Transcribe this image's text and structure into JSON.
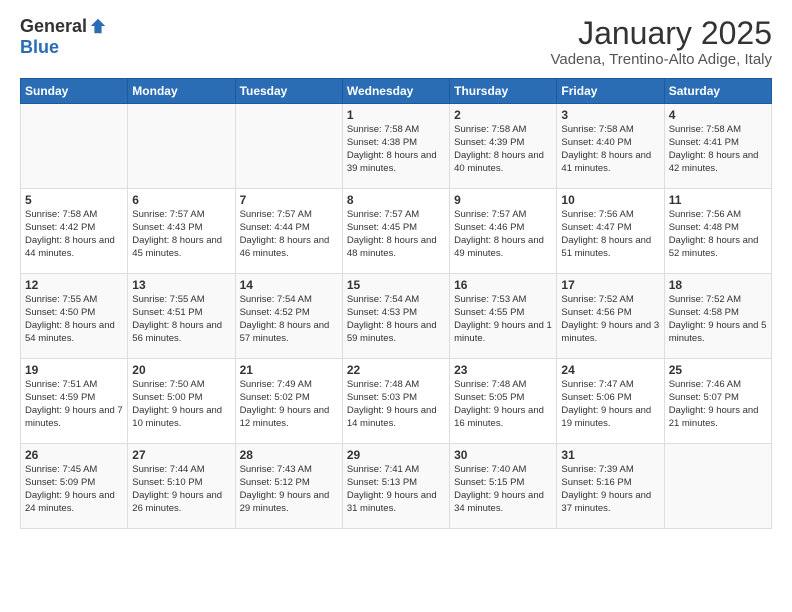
{
  "logo": {
    "general": "General",
    "blue": "Blue"
  },
  "header": {
    "month": "January 2025",
    "location": "Vadena, Trentino-Alto Adige, Italy"
  },
  "weekdays": [
    "Sunday",
    "Monday",
    "Tuesday",
    "Wednesday",
    "Thursday",
    "Friday",
    "Saturday"
  ],
  "weeks": [
    [
      {
        "day": "",
        "info": ""
      },
      {
        "day": "",
        "info": ""
      },
      {
        "day": "",
        "info": ""
      },
      {
        "day": "1",
        "info": "Sunrise: 7:58 AM\nSunset: 4:38 PM\nDaylight: 8 hours and 39 minutes."
      },
      {
        "day": "2",
        "info": "Sunrise: 7:58 AM\nSunset: 4:39 PM\nDaylight: 8 hours and 40 minutes."
      },
      {
        "day": "3",
        "info": "Sunrise: 7:58 AM\nSunset: 4:40 PM\nDaylight: 8 hours and 41 minutes."
      },
      {
        "day": "4",
        "info": "Sunrise: 7:58 AM\nSunset: 4:41 PM\nDaylight: 8 hours and 42 minutes."
      }
    ],
    [
      {
        "day": "5",
        "info": "Sunrise: 7:58 AM\nSunset: 4:42 PM\nDaylight: 8 hours and 44 minutes."
      },
      {
        "day": "6",
        "info": "Sunrise: 7:57 AM\nSunset: 4:43 PM\nDaylight: 8 hours and 45 minutes."
      },
      {
        "day": "7",
        "info": "Sunrise: 7:57 AM\nSunset: 4:44 PM\nDaylight: 8 hours and 46 minutes."
      },
      {
        "day": "8",
        "info": "Sunrise: 7:57 AM\nSunset: 4:45 PM\nDaylight: 8 hours and 48 minutes."
      },
      {
        "day": "9",
        "info": "Sunrise: 7:57 AM\nSunset: 4:46 PM\nDaylight: 8 hours and 49 minutes."
      },
      {
        "day": "10",
        "info": "Sunrise: 7:56 AM\nSunset: 4:47 PM\nDaylight: 8 hours and 51 minutes."
      },
      {
        "day": "11",
        "info": "Sunrise: 7:56 AM\nSunset: 4:48 PM\nDaylight: 8 hours and 52 minutes."
      }
    ],
    [
      {
        "day": "12",
        "info": "Sunrise: 7:55 AM\nSunset: 4:50 PM\nDaylight: 8 hours and 54 minutes."
      },
      {
        "day": "13",
        "info": "Sunrise: 7:55 AM\nSunset: 4:51 PM\nDaylight: 8 hours and 56 minutes."
      },
      {
        "day": "14",
        "info": "Sunrise: 7:54 AM\nSunset: 4:52 PM\nDaylight: 8 hours and 57 minutes."
      },
      {
        "day": "15",
        "info": "Sunrise: 7:54 AM\nSunset: 4:53 PM\nDaylight: 8 hours and 59 minutes."
      },
      {
        "day": "16",
        "info": "Sunrise: 7:53 AM\nSunset: 4:55 PM\nDaylight: 9 hours and 1 minute."
      },
      {
        "day": "17",
        "info": "Sunrise: 7:52 AM\nSunset: 4:56 PM\nDaylight: 9 hours and 3 minutes."
      },
      {
        "day": "18",
        "info": "Sunrise: 7:52 AM\nSunset: 4:58 PM\nDaylight: 9 hours and 5 minutes."
      }
    ],
    [
      {
        "day": "19",
        "info": "Sunrise: 7:51 AM\nSunset: 4:59 PM\nDaylight: 9 hours and 7 minutes."
      },
      {
        "day": "20",
        "info": "Sunrise: 7:50 AM\nSunset: 5:00 PM\nDaylight: 9 hours and 10 minutes."
      },
      {
        "day": "21",
        "info": "Sunrise: 7:49 AM\nSunset: 5:02 PM\nDaylight: 9 hours and 12 minutes."
      },
      {
        "day": "22",
        "info": "Sunrise: 7:48 AM\nSunset: 5:03 PM\nDaylight: 9 hours and 14 minutes."
      },
      {
        "day": "23",
        "info": "Sunrise: 7:48 AM\nSunset: 5:05 PM\nDaylight: 9 hours and 16 minutes."
      },
      {
        "day": "24",
        "info": "Sunrise: 7:47 AM\nSunset: 5:06 PM\nDaylight: 9 hours and 19 minutes."
      },
      {
        "day": "25",
        "info": "Sunrise: 7:46 AM\nSunset: 5:07 PM\nDaylight: 9 hours and 21 minutes."
      }
    ],
    [
      {
        "day": "26",
        "info": "Sunrise: 7:45 AM\nSunset: 5:09 PM\nDaylight: 9 hours and 24 minutes."
      },
      {
        "day": "27",
        "info": "Sunrise: 7:44 AM\nSunset: 5:10 PM\nDaylight: 9 hours and 26 minutes."
      },
      {
        "day": "28",
        "info": "Sunrise: 7:43 AM\nSunset: 5:12 PM\nDaylight: 9 hours and 29 minutes."
      },
      {
        "day": "29",
        "info": "Sunrise: 7:41 AM\nSunset: 5:13 PM\nDaylight: 9 hours and 31 minutes."
      },
      {
        "day": "30",
        "info": "Sunrise: 7:40 AM\nSunset: 5:15 PM\nDaylight: 9 hours and 34 minutes."
      },
      {
        "day": "31",
        "info": "Sunrise: 7:39 AM\nSunset: 5:16 PM\nDaylight: 9 hours and 37 minutes."
      },
      {
        "day": "",
        "info": ""
      }
    ]
  ]
}
